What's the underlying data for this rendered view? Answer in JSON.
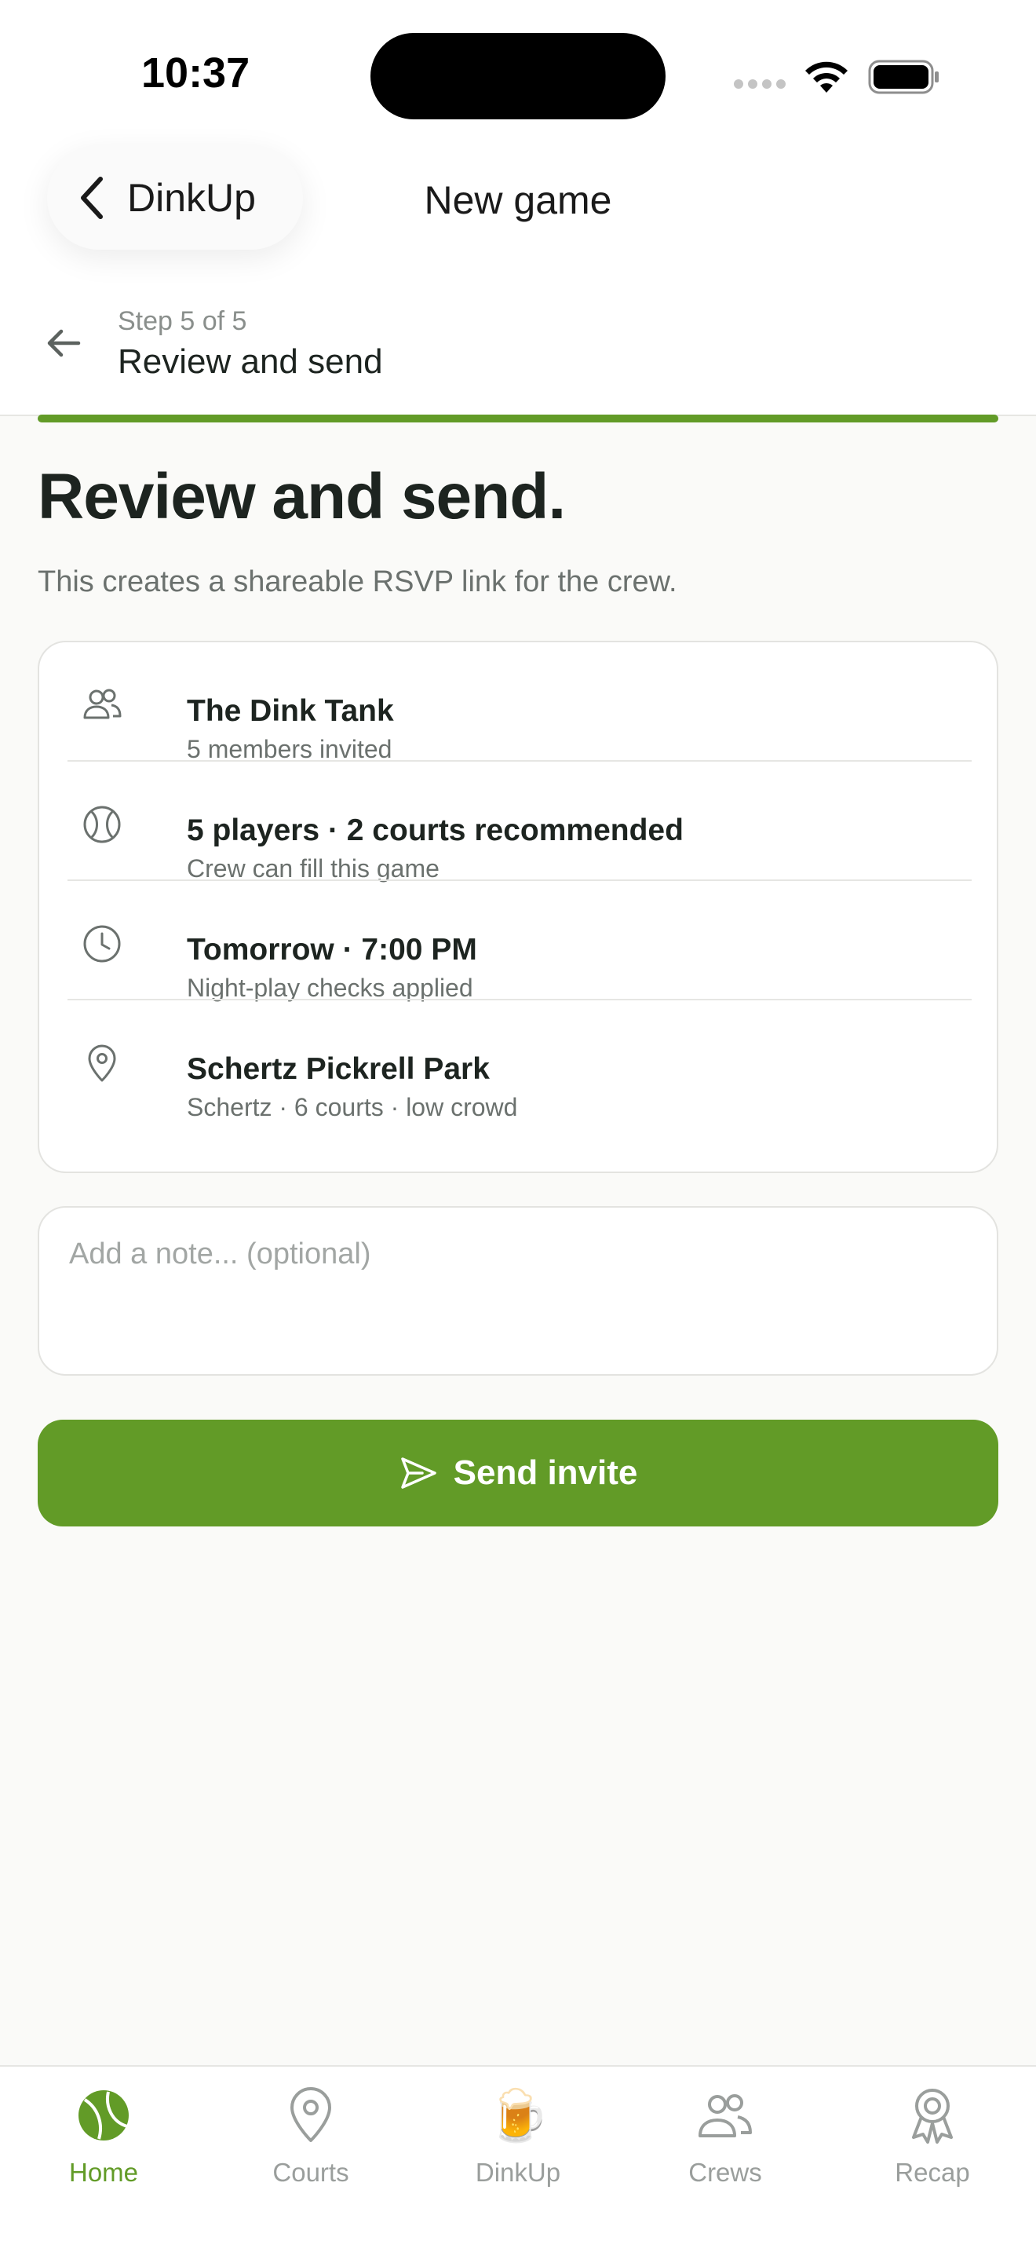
{
  "status_bar": {
    "time": "10:37"
  },
  "nav": {
    "back_label": "DinkUp",
    "title": "New game"
  },
  "step": {
    "label": "Step 5 of 5",
    "title": "Review and send",
    "progress": 1.0
  },
  "page": {
    "heading": "Review and send.",
    "subtitle": "This creates a shareable RSVP link for the crew."
  },
  "summary": [
    {
      "icon": "people-icon",
      "title": "The Dink Tank",
      "subtitle": "5 members invited"
    },
    {
      "icon": "ball-icon",
      "title": "5 players · 2 courts recommended",
      "subtitle": "Crew can fill this game"
    },
    {
      "icon": "clock-icon",
      "title": "Tomorrow · 7:00 PM",
      "subtitle": "Night-play checks applied"
    },
    {
      "icon": "location-pin-icon",
      "title": "Schertz Pickrell Park",
      "subtitle": "Schertz · 6 courts · low crowd"
    }
  ],
  "note": {
    "placeholder": "Add a note... (optional)",
    "value": ""
  },
  "send_button": {
    "label": "Send invite"
  },
  "tabs": [
    {
      "label": "Home",
      "icon": "ball-icon",
      "active": true
    },
    {
      "label": "Courts",
      "icon": "location-pin-icon",
      "active": false
    },
    {
      "label": "DinkUp",
      "icon": "beer-mug-icon",
      "glyph": "🍺",
      "active": false
    },
    {
      "label": "Crews",
      "icon": "people-icon",
      "active": false
    },
    {
      "label": "Recap",
      "icon": "award-ribbon-icon",
      "active": false
    }
  ],
  "colors": {
    "accent": "#629b27",
    "text": "#1d2420",
    "muted": "#6b716e",
    "border": "#e3e3e0",
    "background": "#fafaf8"
  }
}
